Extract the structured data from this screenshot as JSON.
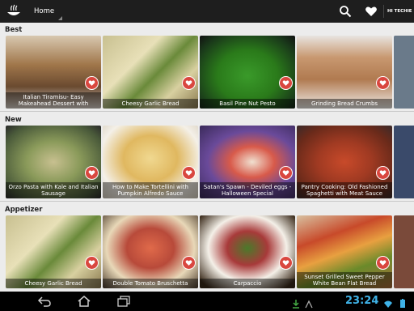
{
  "actionbar": {
    "nav_label": "Home",
    "user_label": "HI TECHIE"
  },
  "sections": [
    {
      "title": "Best",
      "cards": [
        {
          "caption": "Italian Tiramisu- Easy Makeahead Dessert with",
          "bg": "#8a6a4f"
        },
        {
          "caption": "Cheesy Garlic Bread",
          "bg": "#b7b07a"
        },
        {
          "caption": "Basil Pine Nut Pesto",
          "bg": "#2f7a2a"
        },
        {
          "caption": "Grinding Bread Crumbs",
          "bg": "#c9a882"
        }
      ]
    },
    {
      "title": "New",
      "cards": [
        {
          "caption": "Orzo Pasta with Kale and Italian Sausage",
          "bg": "#7d8a5a"
        },
        {
          "caption": "How to Make Tortellini with Pumpkin Alfredo Sauce",
          "bg": "#d9b56a"
        },
        {
          "caption": "Satan's Spawn - Deviled eggs - Halloween Special",
          "bg": "#6a4a8a"
        },
        {
          "caption": "Pantry Cooking: Old Fashioned Spaghetti with Meat Sauce",
          "bg": "#9a3a2a"
        }
      ]
    },
    {
      "title": "Appetizer",
      "cards": [
        {
          "caption": "Cheesy Garlic Bread",
          "bg": "#b7b07a"
        },
        {
          "caption": "Double Tomato Bruschetta",
          "bg": "#a84a3a"
        },
        {
          "caption": "Carpaccio",
          "bg": "#7a2a2a"
        },
        {
          "caption": "Sunset Grilled Sweet Pepper White Bean Flat Bread",
          "bg": "#a86a3a"
        }
      ]
    }
  ],
  "statusbar": {
    "time": "23:24"
  },
  "colors": {
    "actionbar": "#1e1e1e",
    "favorite": "#d9473f",
    "clock": "#3fb3e8",
    "background": "#ececec"
  },
  "icons": [
    "app-logo-icon",
    "search-icon",
    "heart-icon",
    "back-icon",
    "home-icon",
    "recent-apps-icon",
    "download-icon",
    "wifi-icon",
    "battery-icon"
  ]
}
